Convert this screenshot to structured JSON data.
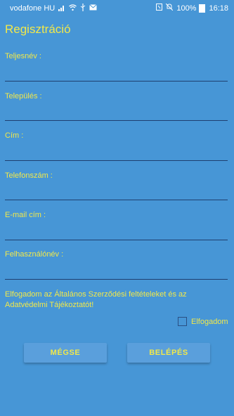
{
  "statusbar": {
    "carrier": "vodafone HU",
    "battery": "100%",
    "time": "16:18"
  },
  "page": {
    "title": "Regisztráció"
  },
  "fields": [
    {
      "label": "Teljesnév :"
    },
    {
      "label": "Település :"
    },
    {
      "label": "Cím :"
    },
    {
      "label": "Telefonszám :"
    },
    {
      "label": "E-mail cím :"
    },
    {
      "label": "Felhasználónév :"
    }
  ],
  "terms": {
    "text": "Elfogadom az Általános Szerződési feltételeket és az Adatvédelmi Tájékoztatót!",
    "checkbox_label": "Elfogadom",
    "checked": false
  },
  "buttons": {
    "cancel": "MÉGSE",
    "login": "BELÉPÉS"
  },
  "colors": {
    "background": "#4796d6",
    "text": "#f1e84a",
    "underline": "#1f3f70"
  }
}
